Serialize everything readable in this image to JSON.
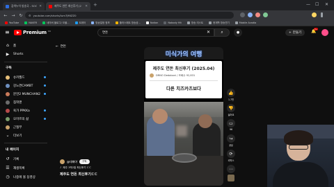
{
  "browser": {
    "tabs": [
      {
        "title": "검색누이 방송국 - SOOP",
        "active": false
      },
      {
        "title": "제주도 연돈 최신후기 (2",
        "active": true
      }
    ],
    "url": "youtube.com/shorts/lum7JMIZZ0",
    "bookmarks": [
      {
        "label": "YouTube",
        "color": "#ff0000"
      },
      {
        "label": "NAVER",
        "color": "#03c75a"
      },
      {
        "label": "네이버 블로그/ 오블...",
        "color": "#03c75a"
      },
      {
        "label": "트위터",
        "color": "#1d9bf0"
      },
      {
        "label": "방송일정 정보",
        "color": "#8ab4f8"
      },
      {
        "label": "플러스패트 방송공...",
        "color": "#f4b400"
      },
      {
        "label": "Notion",
        "color": "#ffffff"
      },
      {
        "label": "Nobody Hit",
        "color": "#5f6368"
      },
      {
        "label": "방송 리스트",
        "color": "#9aa0a6"
      },
      {
        "label": "현재학 방송연기",
        "color": "#9aa0a6"
      },
      {
        "label": "Mobile Acadia",
        "color": "#9aa0a6"
      }
    ]
  },
  "masthead": {
    "logo_text": "Premium",
    "logo_region": "KR",
    "search_value": "연돈",
    "create_label": "만들기",
    "notification_count": "9+"
  },
  "sidebar": {
    "top": [
      {
        "label": "홈",
        "icon": "home-icon"
      },
      {
        "label": "Shorts",
        "icon": "shorts-icon"
      }
    ],
    "subscriptions_header": "구독",
    "subscriptions": [
      {
        "label": "슈카월드",
        "color": "#e8c07a",
        "live": true
      },
      {
        "label": "강느연CAMBT",
        "color": "#6e8fbf",
        "live": true
      },
      {
        "label": "문먼2 MUNCHAN2",
        "color": "#c87a5a",
        "live": true
      },
      {
        "label": "침착맨",
        "color": "#6c6c6c",
        "live": false
      },
      {
        "label": "육가 PPKKa",
        "color": "#b64a4a",
        "live": true
      },
      {
        "label": "오마르의 삶",
        "color": "#7a9c6a",
        "live": true
      },
      {
        "label": "근칠부",
        "color": "#c9a26b",
        "live": false
      },
      {
        "label": "더보기",
        "color": "",
        "live": false
      }
    ],
    "me_header": "내 페이지",
    "me": [
      {
        "label": "기록",
        "icon": "history-icon"
      },
      {
        "label": "재생목록",
        "icon": "playlist-icon"
      },
      {
        "label": "나중에 볼 동영상",
        "icon": "clock-icon"
      }
    ]
  },
  "short": {
    "overlay_title": "미식가의 여행",
    "card_title": "제주도 연돈 최신후기 (2025.04)",
    "card_channel": "DRNO Dedoboni / 조회수 92,831",
    "card_subtitle": "다른 치즈카츠보다",
    "channel": "@대패야",
    "subscribe_label": "구독",
    "song": "제주 1박2일 최신후기 ㄷㄷ",
    "video_title": "제주도 연돈 최신후기ㄷㄷ"
  },
  "actions": {
    "like_count": "1.7천",
    "dislike_label": "싫어요",
    "comment_count": "96",
    "share_label": "공유",
    "remix_label": "리믹스"
  },
  "back_label": "연돈"
}
